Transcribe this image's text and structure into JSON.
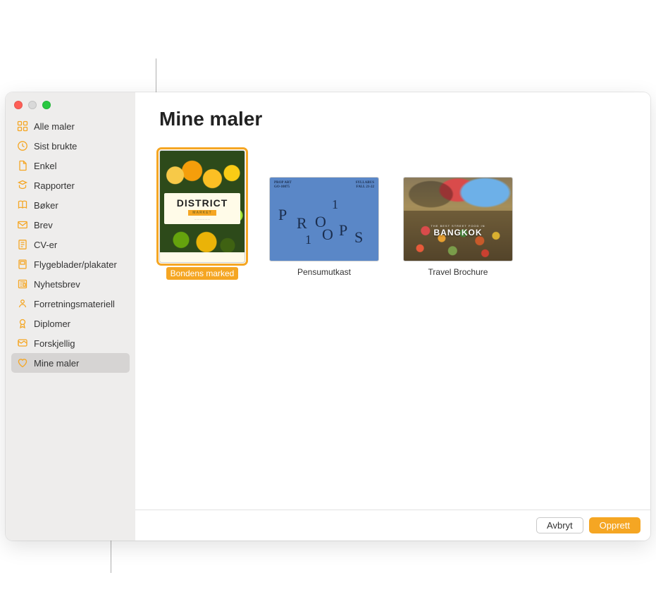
{
  "header": {
    "title": "Mine maler"
  },
  "sidebar": {
    "items": [
      {
        "label": "Alle maler",
        "icon": "grid-icon"
      },
      {
        "label": "Sist brukte",
        "icon": "clock-icon"
      },
      {
        "label": "Enkel",
        "icon": "doc-icon"
      },
      {
        "label": "Rapporter",
        "icon": "report-icon"
      },
      {
        "label": "Bøker",
        "icon": "book-icon"
      },
      {
        "label": "Brev",
        "icon": "letter-icon"
      },
      {
        "label": "CV-er",
        "icon": "cv-icon"
      },
      {
        "label": "Flygeblader/plakater",
        "icon": "poster-icon"
      },
      {
        "label": "Nyhetsbrev",
        "icon": "newsletter-icon"
      },
      {
        "label": "Forretningsmateriell",
        "icon": "business-icon"
      },
      {
        "label": "Diplomer",
        "icon": "diploma-icon"
      },
      {
        "label": "Forskjellig",
        "icon": "misc-icon"
      },
      {
        "label": "Mine maler",
        "icon": "heart-icon"
      }
    ],
    "selectedIndex": 12
  },
  "templates": [
    {
      "label": "Bondens marked",
      "selected": true,
      "orientation": "portrait",
      "thumb": {
        "title": "DISTRICT",
        "subtitle": "MARKET"
      }
    },
    {
      "label": "Pensumutkast",
      "selected": false,
      "orientation": "landscape",
      "thumb": {
        "topLeft1": "PROP ART",
        "topLeft2": "GO-10875",
        "topRight1": "SYLLABUS",
        "topRight2": "FALL 21-22",
        "letters": "P R O P S 1 1"
      }
    },
    {
      "label": "Travel Brochure",
      "selected": false,
      "orientation": "landscape",
      "thumb": {
        "overline": "THE BEST STREET FOOD IN",
        "title": "BANGKOK"
      }
    }
  ],
  "footer": {
    "cancel": "Avbryt",
    "create": "Opprett"
  },
  "colors": {
    "accent": "#f5a623"
  }
}
